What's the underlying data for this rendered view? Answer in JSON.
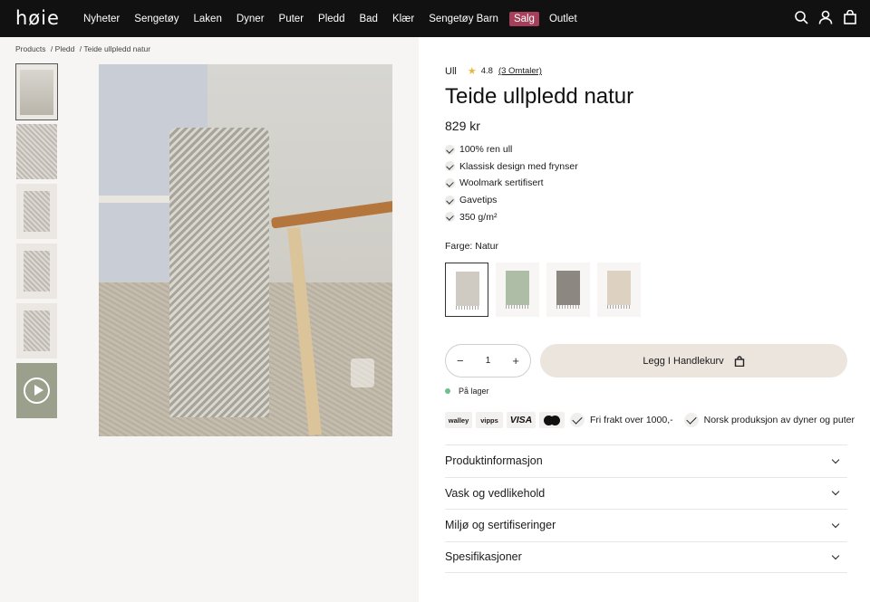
{
  "header": {
    "logo": "høie",
    "nav": [
      "Nyheter",
      "Sengetøy",
      "Laken",
      "Dyner",
      "Puter",
      "Pledd",
      "Bad",
      "Klær",
      "Sengetøy Barn",
      "Salg",
      "Outlet"
    ],
    "icons": [
      "search-icon",
      "user-icon",
      "bag-icon"
    ]
  },
  "breadcrumb": [
    "Products",
    "/ Pledd",
    "/ Teide ullpledd natur"
  ],
  "product": {
    "category": "Ull",
    "rating": "4.8",
    "reviews": "(3 Omtaler)",
    "title": "Teide ullpledd natur",
    "price": "829 kr",
    "features": [
      "100% ren ull",
      "Klassisk design med frynser",
      "Woolmark sertifisert",
      "Gavetips",
      "350 g/m²"
    ],
    "color_label": "Farge: Natur",
    "swatch_colors": [
      "#cfcbc3",
      "#aebda6",
      "#8d8782",
      "#ddd2c2"
    ],
    "quantity": "1",
    "qty_minus": "−",
    "qty_plus": "+",
    "add_to_cart": "Legg I Handlekurv",
    "stock": "På lager"
  },
  "payments": [
    "walley",
    "vipps",
    "VISA"
  ],
  "usps": [
    "Fri frakt over 1000,-",
    "Norsk produksjon av dyner og puter"
  ],
  "accordion": [
    "Produktinformasjon",
    "Vask og vedlikehold",
    "Miljø og sertifiseringer",
    "Spesifikasjoner"
  ],
  "colors": {
    "sale": "#a6405a",
    "add_button_bg": "#ebe5de",
    "in_stock": "#6cc08b",
    "rating_star": "#e6b93e"
  }
}
